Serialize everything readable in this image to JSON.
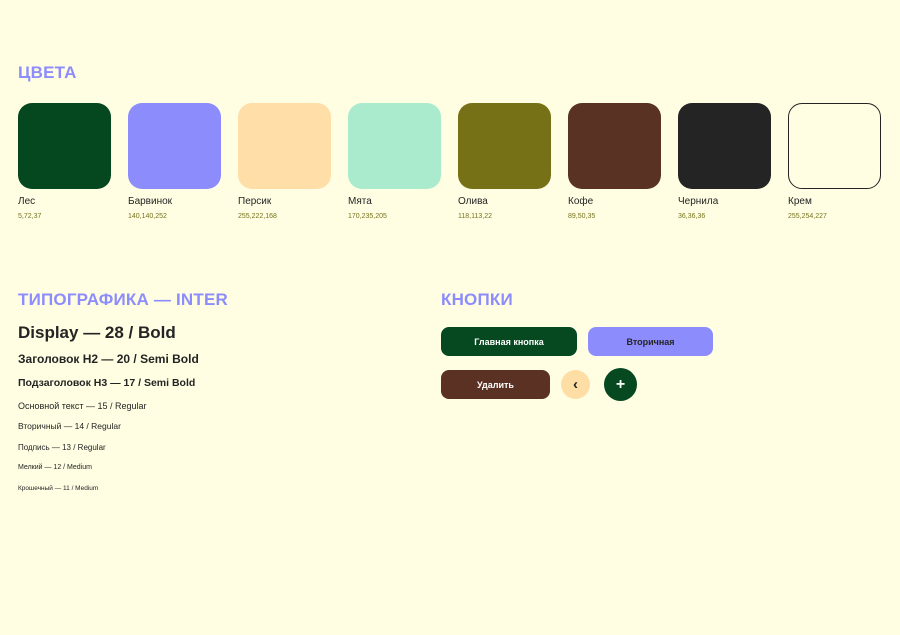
{
  "colors": {
    "title": "ЦВЕТА",
    "swatches": [
      {
        "name": "Лес",
        "rgb": "5,72,37",
        "hex": "#05481F",
        "border": ""
      },
      {
        "name": "Барвинок",
        "rgb": "140,140,252",
        "hex": "#8C8CFC",
        "border": ""
      },
      {
        "name": "Персик",
        "rgb": "255,222,168",
        "hex": "#FFDEA8",
        "border": ""
      },
      {
        "name": "Мята",
        "rgb": "170,235,205",
        "hex": "#AAEBCD",
        "border": ""
      },
      {
        "name": "Олива",
        "rgb": "118,113,22",
        "hex": "#767116",
        "border": ""
      },
      {
        "name": "Кофе",
        "rgb": "89,50,35",
        "hex": "#593223",
        "border": ""
      },
      {
        "name": "Чернила",
        "rgb": "36,36,36",
        "hex": "#242424",
        "border": ""
      },
      {
        "name": "Крем",
        "rgb": "255,254,227",
        "hex": "#FFFEE3",
        "border": "#242424"
      }
    ]
  },
  "typography": {
    "title": "ТИПОГРАФИКА — INTER",
    "display": "Display — 28 / Bold",
    "h2": "Заголовок H2 — 20 / Semi Bold",
    "h3": "Подзаголовок H3 — 17 / Semi Bold",
    "body": "Основной текст — 15 / Regular",
    "secondary": "Вторичный — 14 / Regular",
    "caption": "Подпись — 13 / Regular",
    "small": "Мелкий — 12 / Medium",
    "tiny": "Крошечный — 11 / Medium"
  },
  "buttons": {
    "title": "КНОПКИ",
    "primary_label": "Главная кнопка",
    "secondary_label": "Вторичная",
    "delete_label": "Удалить",
    "back_icon": "‹",
    "back_icon_name": "chevron-left-icon",
    "add_icon": "+",
    "add_icon_name": "plus-icon"
  }
}
